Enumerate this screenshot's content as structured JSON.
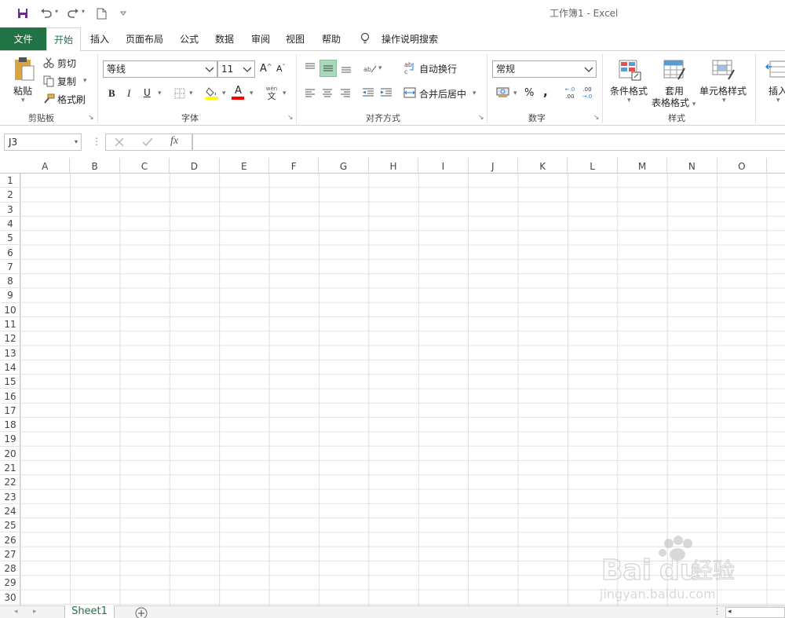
{
  "window": {
    "title": "工作簿1  -  Excel"
  },
  "tabs": {
    "file": "文件",
    "home": "开始",
    "insert": "插入",
    "page_layout": "页面布局",
    "formulas": "公式",
    "data": "数据",
    "review": "审阅",
    "view": "视图",
    "help": "帮助",
    "tell_me": "操作说明搜索"
  },
  "clipboard": {
    "paste": "粘贴",
    "cut": "剪切",
    "copy": "复制",
    "format_painter": "格式刷",
    "group_label": "剪贴板"
  },
  "font": {
    "font_name": "等线",
    "font_size": "11",
    "grow": "A",
    "shrink": "A",
    "bold": "B",
    "italic": "I",
    "underline": "U",
    "font_color": "A",
    "phonetic_top": "wén",
    "phonetic_bottom": "文",
    "group_label": "字体"
  },
  "alignment": {
    "wrap_text": "自动换行",
    "merge_center": "合并后居中",
    "group_label": "对齐方式"
  },
  "number": {
    "format": "常规",
    "percent": "%",
    "comma": ",",
    "inc_decimal_top": "←.0",
    "inc_decimal_bottom": ".00",
    "dec_decimal_top": ".00",
    "dec_decimal_bottom": "→.0",
    "group_label": "数字"
  },
  "styles": {
    "conditional": "条件格式",
    "table_line1": "套用",
    "table_line2": "表格格式",
    "cell_styles": "单元格样式",
    "group_label": "样式"
  },
  "cells": {
    "insert": "插入"
  },
  "formula_bar": {
    "name_box": "J3",
    "fx": "fx",
    "value": ""
  },
  "grid": {
    "columns": [
      "A",
      "B",
      "C",
      "D",
      "E",
      "F",
      "G",
      "H",
      "I",
      "J",
      "K",
      "L",
      "M",
      "N",
      "O"
    ],
    "rows": [
      "1",
      "2",
      "3",
      "4",
      "5",
      "6",
      "7",
      "8",
      "9",
      "10",
      "11",
      "12",
      "13",
      "14",
      "15",
      "16",
      "17",
      "18",
      "19",
      "20",
      "21",
      "22",
      "23",
      "24",
      "25",
      "26",
      "27",
      "28",
      "29",
      "30"
    ]
  },
  "sheets": {
    "active": "Sheet1"
  },
  "watermark": {
    "brand_prefix": "Bai",
    "brand_suffix": "du",
    "brand_cn": "经验",
    "url": "jingyan.baidu.com"
  },
  "colors": {
    "accent": "#217346",
    "highlight": "#a8d8b8",
    "gridline": "#e3e3e3"
  }
}
